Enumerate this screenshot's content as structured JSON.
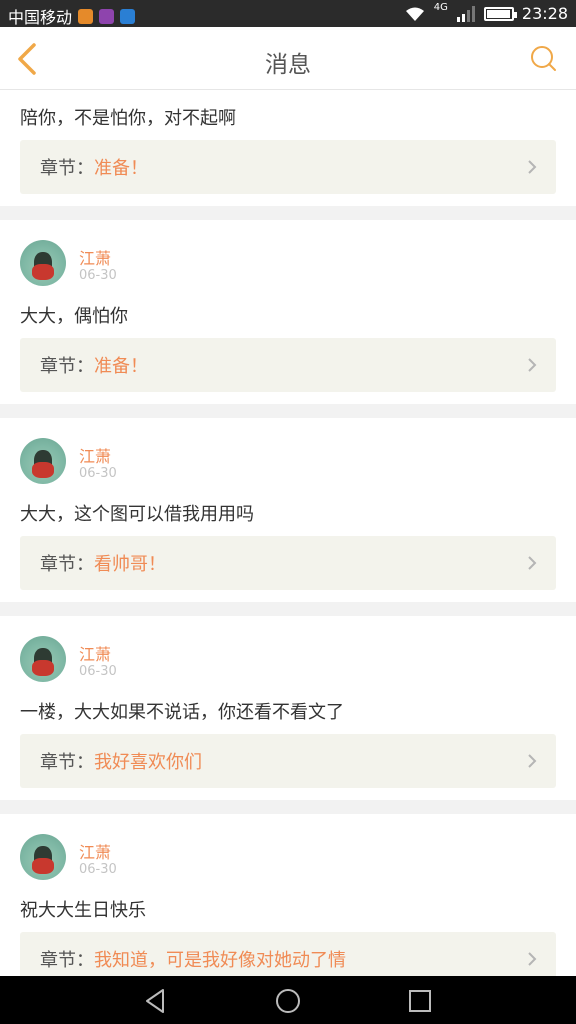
{
  "status_bar": {
    "carrier": "中国移动",
    "network": "4G",
    "time": "23:28",
    "battery_level": 0.9,
    "app_icon_colors": [
      "#e58a2a",
      "#8e44ad",
      "#2a7fd4"
    ]
  },
  "header": {
    "title": "消息",
    "back_icon": "chevron-left-icon",
    "search_icon": "search-icon",
    "accent_color": "#f0a848"
  },
  "colors": {
    "accent": "#f08b55",
    "card_bg": "#ffffff",
    "chapter_bg": "#f3f3ec",
    "page_bg": "#f2f2f2"
  },
  "messages": [
    {
      "message": "陪你，不是怕你，对不起啊",
      "chapter_label": "章节：",
      "chapter_name": "准备！"
    },
    {
      "author": "江萧",
      "date": "06-30",
      "message": "大大，偶怕你",
      "chapter_label": "章节：",
      "chapter_name": "准备！"
    },
    {
      "author": "江萧",
      "date": "06-30",
      "message": "大大，这个图可以借我用用吗",
      "chapter_label": "章节：",
      "chapter_name": "看帅哥！"
    },
    {
      "author": "江萧",
      "date": "06-30",
      "message": "一楼，大大如果不说话，你还看不看文了",
      "chapter_label": "章节：",
      "chapter_name": "我好喜欢你们"
    },
    {
      "author": "江萧",
      "date": "06-30",
      "message": "祝大大生日快乐",
      "chapter_label": "章节：",
      "chapter_name": "我知道，可是我好像对她动了情"
    }
  ],
  "nav_bar": {
    "back_icon": "triangle-back-icon",
    "home_icon": "circle-home-icon",
    "recents_icon": "square-recents-icon"
  }
}
